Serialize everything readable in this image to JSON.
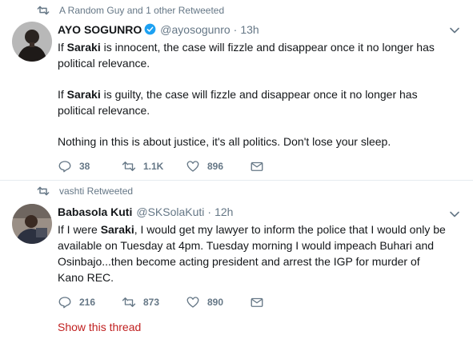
{
  "tweets": [
    {
      "retweeted_by": "A Random Guy and 1 other Retweeted",
      "name": "AYO SOGUNRO",
      "verified": true,
      "handle": "@ayosogunro",
      "separator": "·",
      "time": "13h",
      "paragraphs": [
        [
          {
            "t": "If "
          },
          {
            "t": "Saraki",
            "b": true
          },
          {
            "t": " is innocent, the case will fizzle and disappear once it no longer has political relevance."
          }
        ],
        [
          {
            "t": "If "
          },
          {
            "t": "Saraki",
            "b": true
          },
          {
            "t": " is guilty, the case will fizzle and disappear once it no longer has political relevance."
          }
        ],
        [
          {
            "t": "Nothing in this is about justice, it's all politics. Don't lose your sleep."
          }
        ]
      ],
      "replies": "38",
      "retweets": "1.1K",
      "likes": "896"
    },
    {
      "retweeted_by": "vashti Retweeted",
      "name": "Babasola Kuti",
      "verified": false,
      "handle": "@SKSolaKuti",
      "separator": "·",
      "time": "12h",
      "paragraphs": [
        [
          {
            "t": "If I were "
          },
          {
            "t": "Saraki",
            "b": true
          },
          {
            "t": ", I would get my lawyer to inform the police that I would only be available on Tuesday at 4pm. Tuesday morning I would impeach Buhari and Osinbajo...then become acting president and arrest the IGP for murder of Kano REC."
          }
        ]
      ],
      "replies": "216",
      "retweets": "873",
      "likes": "890"
    }
  ],
  "show_thread": "Show this thread",
  "colors": {
    "text": "#14171a",
    "secondary": "#657786",
    "verified": "#1da1f2",
    "show_thread": "#c02020",
    "divider": "#e6ecf0"
  }
}
